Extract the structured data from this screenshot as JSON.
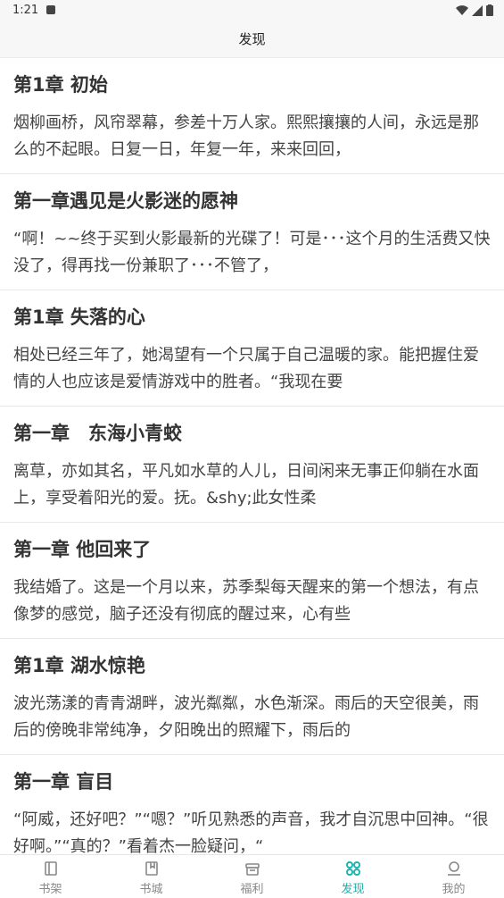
{
  "status_bar": {
    "time": "1:21"
  },
  "header": {
    "title": "发现"
  },
  "feed": [
    {
      "title": "第1章 初始",
      "excerpt": "烟柳画桥，风帘翠幕，参差十万人家。熙熙攘攘的人间，永远是那么的不起眼。日复一日，年复一年，来来回回，"
    },
    {
      "title": "第一章遇见是火影迷的愿神",
      "excerpt": "“啊！~~终于买到火影最新的光碟了！可是･･･这个月的生活费又快没了，得再找一份兼职了･･･不管了，"
    },
    {
      "title": "第1章 失落的心",
      "excerpt": "相处已经三年了，她渴望有一个只属于自己温暖的家。能把握住爱情的人也应该是爱情游戏中的胜者。“我现在要"
    },
    {
      "title": "第一章　东海小青蛟",
      "excerpt": "离草，亦如其名，平凡如水草的人儿，日间闲来无事正仰躺在水面上，享受着阳光的爱。抚。&shy;此女性柔"
    },
    {
      "title": "第一章 他回来了",
      "excerpt": "我结婚了。这是一个月以来，苏季梨每天醒来的第一个想法，有点像梦的感觉，脑子还没有彻底的醒过来，心有些"
    },
    {
      "title": "第1章 湖水惊艳",
      "excerpt": "波光荡漾的青青湖畔，波光粼粼，水色渐深。雨后的天空很美，雨后的傍晚非常纯净，夕阳晚出的照耀下，雨后的"
    },
    {
      "title": "第一章 盲目",
      "excerpt": "“阿威，还好吧？”“嗯？”听见熟悉的声音，我才自沉思中回神。“很好啊。”“真的？”看着杰一脸疑问，“"
    }
  ],
  "bottom_nav": [
    {
      "label": "书架",
      "icon": "bookshelf-icon",
      "active": false
    },
    {
      "label": "书城",
      "icon": "book-icon",
      "active": false
    },
    {
      "label": "福利",
      "icon": "gift-icon",
      "active": false
    },
    {
      "label": "发现",
      "icon": "discover-icon",
      "active": true
    },
    {
      "label": "我的",
      "icon": "profile-icon",
      "active": false
    }
  ],
  "colors": {
    "accent": "#1cb5b0",
    "inactive": "#888888",
    "header_bg": "#f7f7f7"
  }
}
